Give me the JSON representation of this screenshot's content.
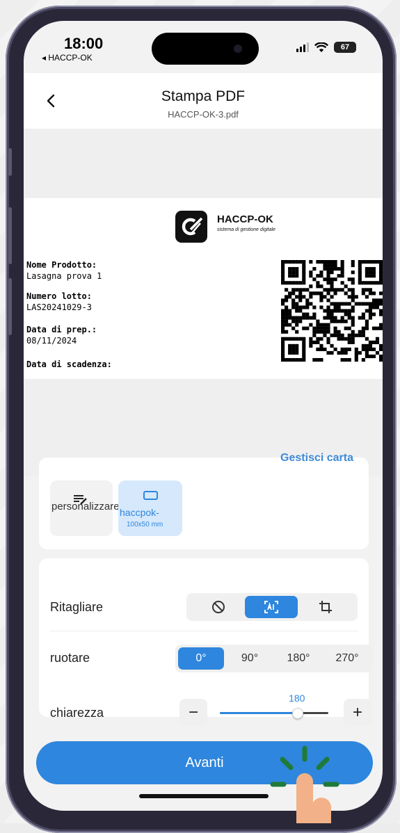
{
  "status_bar": {
    "time": "18:00",
    "back_app": "◂ HACCP-OK",
    "battery": "67"
  },
  "header": {
    "title": "Stampa PDF",
    "filename": "HACCP-OK-3.pdf"
  },
  "label_preview": {
    "brand": "HACCP-OK",
    "tagline": "sistema di gestione digitale",
    "fields": [
      {
        "label": "Nome Prodotto:",
        "value": "Lasagna prova 1"
      },
      {
        "label": "Numero lotto:",
        "value": "LAS20241029-3"
      },
      {
        "label": "Data di prep.:",
        "value": "08/11/2024"
      },
      {
        "label": "Data di scadenza:",
        "value": ""
      }
    ]
  },
  "paper": {
    "manage_label": "Gestisci carta",
    "options": [
      {
        "label": "personalizzare"
      },
      {
        "name": "haccpok-",
        "size": "100x50 mm",
        "selected": true
      }
    ]
  },
  "settings": {
    "crop": {
      "label": "Ritagliare",
      "selected_index": 1,
      "options": [
        "none-icon",
        "ai-crop-icon",
        "crop-icon"
      ]
    },
    "rotate": {
      "label": "ruotare",
      "options": [
        "0°",
        "90°",
        "180°",
        "270°"
      ],
      "selected_index": 0
    },
    "brightness": {
      "label": "chiarezza",
      "value": "180",
      "fraction": 0.71,
      "minus": "−",
      "plus": "+"
    }
  },
  "primary_button": {
    "label": "Avanti"
  },
  "colors": {
    "accent": "#2e86de",
    "hint_green": "#1f7a3a",
    "finger": "#f2b188"
  }
}
